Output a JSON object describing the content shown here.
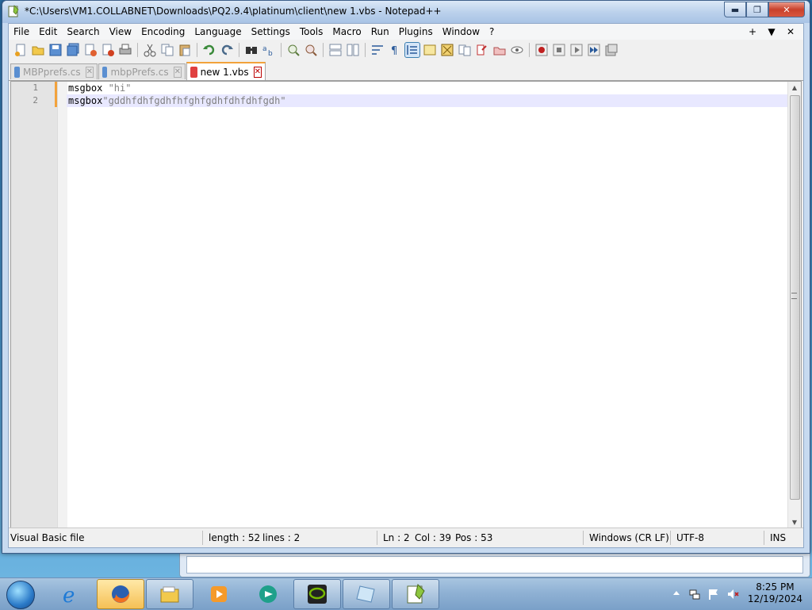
{
  "window": {
    "title": "*C:\\Users\\VM1.COLLABNET\\Downloads\\PQ2.9.4\\platinum\\client\\new 1.vbs - Notepad++",
    "minimize_label": "▬",
    "maximize_label": "❐",
    "close_label": "✕"
  },
  "menu": {
    "items": [
      "File",
      "Edit",
      "Search",
      "View",
      "Encoding",
      "Language",
      "Settings",
      "Tools",
      "Macro",
      "Run",
      "Plugins",
      "Window",
      "?"
    ],
    "right": [
      "+",
      "▼",
      "✕"
    ]
  },
  "toolbar": {
    "icons": [
      "new-file-icon",
      "open-file-icon",
      "save-icon",
      "save-all-icon",
      "close-icon",
      "close-all-icon",
      "print-icon",
      "cut-icon",
      "copy-icon",
      "paste-icon",
      "undo-icon",
      "redo-icon",
      "find-icon",
      "replace-icon",
      "zoom-in-icon",
      "zoom-out-icon",
      "sync-vertical-icon",
      "sync-horizontal-icon",
      "word-wrap-icon",
      "show-all-chars-icon",
      "indent-guide-icon",
      "user-lang-icon",
      "doc-map-icon",
      "function-list-icon",
      "folder-workspace-icon",
      "monitoring-icon",
      "record-macro-icon",
      "stop-record-icon",
      "playback-macro-icon",
      "run-macro-multiple-icon",
      "save-macro-icon"
    ]
  },
  "tabs": [
    {
      "label": "MBPprefs.cs",
      "active": false
    },
    {
      "label": "mbpPrefs.cs",
      "active": false
    },
    {
      "label": "new 1.vbs",
      "active": true
    }
  ],
  "editor": {
    "lines": [
      {
        "num": "1",
        "keyword": "msgbox",
        "string": " \"hi\""
      },
      {
        "num": "2",
        "keyword": "msgbox",
        "string": "\"gddhfdhfgdhfhfghfgdhfdhfdhfgdh\""
      }
    ]
  },
  "status": {
    "file_type": "Visual Basic file",
    "length": "length : 52",
    "lines": "lines : 2",
    "ln": "Ln : 2",
    "col": "Col : 39",
    "pos": "Pos : 53",
    "eol": "Windows (CR LF)",
    "encoding": "UTF-8",
    "mode": "INS"
  },
  "taskbar": {
    "apps": [
      "internet-explorer-icon",
      "firefox-icon",
      "file-explorer-icon",
      "media-player-icon",
      "chat-app-icon",
      "nvidia-icon",
      "notepad-icon",
      "notepadpp-icon"
    ],
    "time": "8:25 PM",
    "date": "12/19/2024"
  }
}
